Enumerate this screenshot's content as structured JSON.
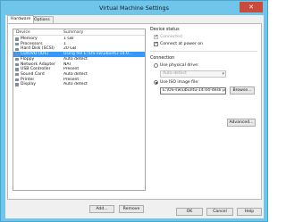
{
  "window": {
    "title": "Virtual Machine Settings",
    "close_symbol": "✕"
  },
  "tabs": [
    {
      "label": "Hardware",
      "active": true
    },
    {
      "label": "Options",
      "active": false
    }
  ],
  "device_list": {
    "columns": [
      "Device",
      "Summary"
    ],
    "rows": [
      {
        "device": "Memory",
        "summary": "1 GB",
        "icon": "memory-icon"
      },
      {
        "device": "Processors",
        "summary": "1",
        "icon": "processor-icon"
      },
      {
        "device": "Hard Disk (SCSI)",
        "summary": "20 GB",
        "icon": "hard-disk-icon"
      },
      {
        "device": "CD/DVD (IDE)",
        "summary": "Using file E:\\OS-sw\\ubuntu-14.0...",
        "icon": "cd-dvd-icon",
        "selected": true
      },
      {
        "device": "Floppy",
        "summary": "Auto detect",
        "icon": "floppy-icon"
      },
      {
        "device": "Network Adapter",
        "summary": "NAT",
        "icon": "network-adapter-icon"
      },
      {
        "device": "USB Controller",
        "summary": "Present",
        "icon": "usb-icon"
      },
      {
        "device": "Sound Card",
        "summary": "Auto detect",
        "icon": "sound-card-icon"
      },
      {
        "device": "Printer",
        "summary": "Present",
        "icon": "printer-icon"
      },
      {
        "device": "Display",
        "summary": "Auto detect",
        "icon": "display-icon"
      }
    ],
    "add_label": "Add...",
    "remove_label": "Remove"
  },
  "device_status": {
    "title": "Device status",
    "connected_label": "Connected",
    "connected_checked": true,
    "connect_power_label": "Connect at power on",
    "connect_power_checked": true
  },
  "connection": {
    "title": "Connection",
    "physical_label": "Use physical drive:",
    "physical_value": "Auto detect",
    "iso_label": "Use ISO image file:",
    "iso_value": "E:\\OS-sw\\ubuntu-14.04-deskto",
    "browse_label": "Browse...",
    "selected": "iso"
  },
  "advanced_label": "Advanced...",
  "footer": {
    "ok": "OK",
    "cancel": "Cancel",
    "help": "Help"
  }
}
